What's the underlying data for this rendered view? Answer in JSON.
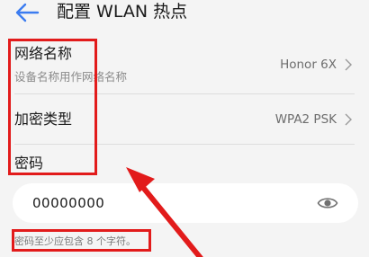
{
  "header": {
    "title": "配置 WLAN 热点",
    "back_icon": "back-arrow-icon"
  },
  "settings": {
    "network_name": {
      "label": "网络名称",
      "sublabel": "设备名称用作网络名称",
      "value": "Honor 6X"
    },
    "encryption": {
      "label": "加密类型",
      "value": "WPA2 PSK"
    },
    "password": {
      "label": "密码",
      "value": "00000000",
      "hint": "密码至少应包含 8 个字符。"
    }
  },
  "colors": {
    "accent": "#3b7cf0",
    "highlight": "#e21b1b",
    "background": "#f4f4f4"
  }
}
